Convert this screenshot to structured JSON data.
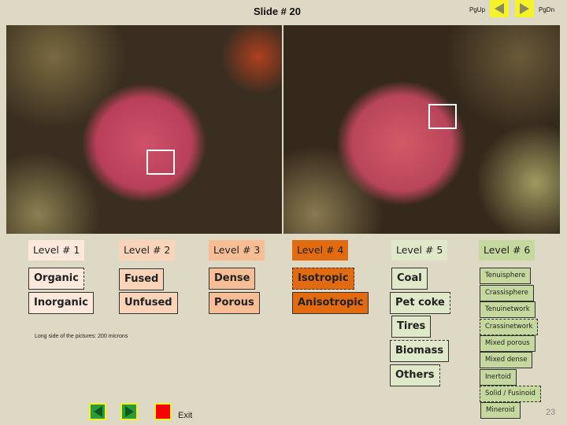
{
  "header": {
    "title": "Slide  # 20",
    "pgup": "PgUp",
    "pgdn": "PgDn"
  },
  "levels": [
    "Level # 1",
    "Level # 2",
    "Level # 3",
    "Level # 4",
    "Level # 5",
    "Level # 6"
  ],
  "level1": [
    "Organic",
    "Inorganic"
  ],
  "level2": [
    "Fused",
    "Unfused"
  ],
  "level3": [
    "Dense",
    "Porous"
  ],
  "level4": [
    "Isotropic",
    "Anisotropic"
  ],
  "level5": [
    "Coal",
    "Pet coke",
    "Tires",
    "Biomass",
    "Others"
  ],
  "level6": [
    "Tenuisphere",
    "Crassisphere",
    "Tenuinetwork",
    "Crassinetwork",
    "Mixed porous",
    "Mixed dense",
    "Inertoid",
    "Solid / Fusinoid",
    "Mineroid"
  ],
  "caption": "Long side of the pictures: 200 microns",
  "footer": {
    "exit": "Exit",
    "page_number": "23"
  },
  "colors": {
    "level1": "#fce9dc",
    "level2": "#fad4b8",
    "level3": "#f7be96",
    "level4": "#e26b10",
    "level5": "#dfe8c9",
    "level6": "#c5d89e",
    "nav": "#f6f22a",
    "exit": "#ff0000"
  }
}
